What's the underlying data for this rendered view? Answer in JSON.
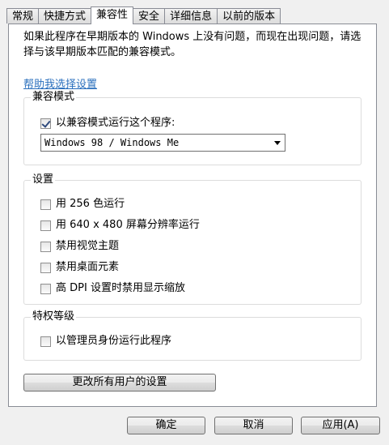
{
  "tabs": [
    {
      "label": "常规"
    },
    {
      "label": "快捷方式"
    },
    {
      "label": "兼容性"
    },
    {
      "label": "安全"
    },
    {
      "label": "详细信息"
    },
    {
      "label": "以前的版本"
    }
  ],
  "description": "如果此程序在早期版本的 Windows 上没有问题，而现在出现问题，请选择与该早期版本匹配的兼容模式。",
  "help_link": "帮助我选择设置",
  "compat_mode": {
    "title": "兼容模式",
    "checkbox_label": "以兼容模式运行这个程序:",
    "checked": true,
    "selected_os": "Windows 98 / Windows Me"
  },
  "settings": {
    "title": "设置",
    "items": [
      {
        "label": "用 256 色运行",
        "checked": false
      },
      {
        "label": "用 640 x 480 屏幕分辨率运行",
        "checked": false
      },
      {
        "label": "禁用视觉主题",
        "checked": false
      },
      {
        "label": "禁用桌面元素",
        "checked": false
      },
      {
        "label": "高 DPI 设置时禁用显示缩放",
        "checked": false
      }
    ]
  },
  "privilege": {
    "title": "特权等级",
    "checkbox_label": "以管理员身份运行此程序",
    "checked": false
  },
  "change_all_button": "更改所有用户的设置",
  "footer": {
    "ok": "确定",
    "cancel": "取消",
    "apply": "应用(A)"
  }
}
